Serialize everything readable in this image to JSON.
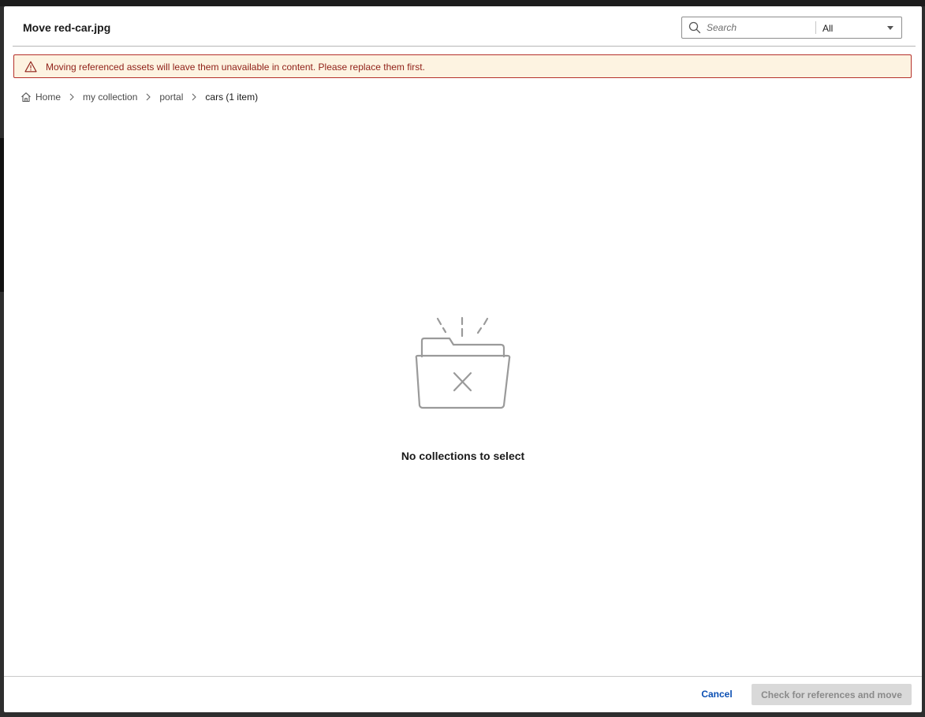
{
  "dialog": {
    "title": "Move red-car.jpg"
  },
  "search": {
    "placeholder": "Search",
    "value": "",
    "filter_selected": "All"
  },
  "alert": {
    "message": "Moving referenced assets will leave them unavailable in content. Please replace them first.",
    "icon": "warning-triangle-icon",
    "color": "#b5302a"
  },
  "breadcrumb": {
    "items": [
      {
        "label": "Home",
        "icon": "home-icon"
      },
      {
        "label": "my collection"
      },
      {
        "label": "portal"
      },
      {
        "label": "cars (1 item)"
      }
    ]
  },
  "empty_state": {
    "icon": "empty-folder-icon",
    "message": "No collections to select"
  },
  "footer": {
    "cancel_label": "Cancel",
    "primary_label": "Check for references and move",
    "primary_disabled": true,
    "link_color": "#0b4fb3"
  }
}
